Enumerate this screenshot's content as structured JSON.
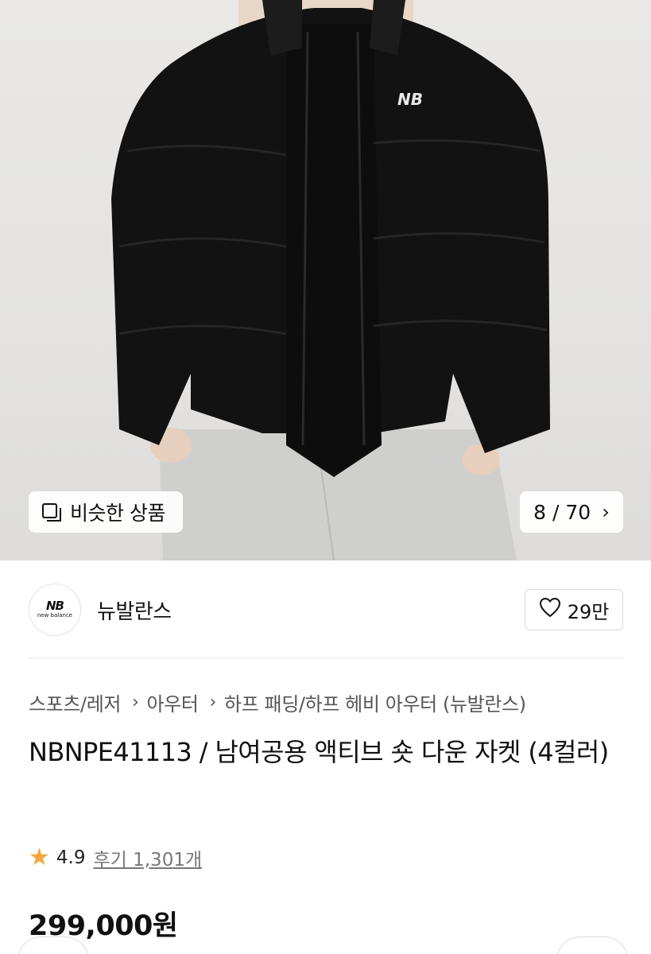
{
  "gallery": {
    "similar_label": "비슷한 상품",
    "counter": "8 / 70",
    "chevron": "›"
  },
  "brand": {
    "logo_mark": "NB",
    "logo_text": "new balance",
    "name": "뉴발란스",
    "like_count": "29만"
  },
  "breadcrumb": [
    "스포츠/레저",
    "아우터",
    "하프 패딩/하프 헤비 아우터 (뉴발란스)"
  ],
  "breadcrumb_sep": "›",
  "product": {
    "title": "NBNPE41113 / 남여공용 액티브 숏 다운 자켓 (4컬러)",
    "rating": "4.9",
    "reviews": "후기 1,301개",
    "price": "299,000원"
  },
  "colors": {
    "star": "#f2a83b",
    "jacket": "#121212",
    "pants": "#cfcfcd"
  }
}
